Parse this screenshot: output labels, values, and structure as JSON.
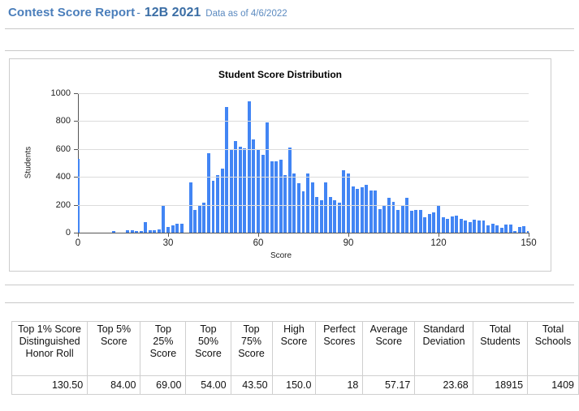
{
  "header": {
    "title": "Contest Score Report",
    "separator": "-",
    "contest": "12B 2021",
    "data_as_of": "Data as of 4/6/2022",
    "title_color": "#4a7ebb"
  },
  "chart_card": {
    "title": "Student Score Distribution"
  },
  "chart_data": {
    "type": "bar",
    "title": "Student Score Distribution",
    "xlabel": "Score",
    "ylabel": "Students",
    "xlim": [
      0,
      150
    ],
    "ylim": [
      0,
      1000
    ],
    "xticks": [
      0,
      30,
      60,
      90,
      120,
      150
    ],
    "yticks": [
      0,
      200,
      400,
      600,
      800,
      1000
    ],
    "grid": true,
    "legend": false,
    "bar_color": "#4285f4",
    "bin_width": 1.5,
    "x": [
      0,
      1.5,
      3,
      4.5,
      6,
      7.5,
      9,
      10.5,
      12,
      13.5,
      15,
      16.5,
      18,
      19.5,
      21,
      22.5,
      24,
      25.5,
      27,
      28.5,
      30,
      31.5,
      33,
      34.5,
      36,
      37.5,
      39,
      40.5,
      42,
      43.5,
      45,
      46.5,
      48,
      49.5,
      51,
      52.5,
      54,
      55.5,
      57,
      58.5,
      60,
      61.5,
      63,
      64.5,
      66,
      67.5,
      69,
      70.5,
      72,
      73.5,
      75,
      76.5,
      78,
      79.5,
      81,
      82.5,
      84,
      85.5,
      87,
      88.5,
      90,
      91.5,
      93,
      94.5,
      96,
      97.5,
      99,
      100.5,
      102,
      103.5,
      105,
      106.5,
      108,
      109.5,
      111,
      112.5,
      114,
      115.5,
      117,
      118.5,
      120,
      121.5,
      123,
      124.5,
      126,
      127.5,
      129,
      130.5,
      132,
      133.5,
      135,
      136.5,
      138,
      139.5,
      141,
      142.5,
      144,
      145.5,
      147,
      148.5,
      150
    ],
    "values": [
      530,
      0,
      0,
      0,
      0,
      0,
      0,
      0,
      10,
      0,
      0,
      20,
      15,
      10,
      10,
      75,
      15,
      20,
      25,
      190,
      40,
      55,
      65,
      65,
      0,
      360,
      160,
      200,
      215,
      570,
      375,
      410,
      460,
      900,
      595,
      655,
      615,
      605,
      940,
      670,
      600,
      560,
      790,
      510,
      510,
      525,
      415,
      610,
      425,
      355,
      295,
      425,
      360,
      255,
      230,
      360,
      255,
      230,
      215,
      445,
      425,
      330,
      315,
      325,
      345,
      300,
      300,
      170,
      195,
      250,
      220,
      160,
      200,
      250,
      155,
      165,
      160,
      110,
      135,
      145,
      200,
      110,
      100,
      115,
      120,
      100,
      90,
      75,
      95,
      85,
      90,
      55,
      65,
      50,
      35,
      60,
      60,
      10,
      40,
      45,
      10,
      35
    ]
  },
  "stats_table": {
    "columns": [
      "Top 1% Score Distinguished Honor Roll",
      "Top 5% Score",
      "Top 25% Score",
      "Top 50% Score",
      "Top 75% Score",
      "High Score",
      "Perfect Scores",
      "Average Score",
      "Standard Deviation",
      "Total Students",
      "Total Schools"
    ],
    "values": [
      "130.50",
      "84.00",
      "69.00",
      "54.00",
      "43.50",
      "150.0",
      "18",
      "57.17",
      "23.68",
      "18915",
      "1409"
    ]
  }
}
